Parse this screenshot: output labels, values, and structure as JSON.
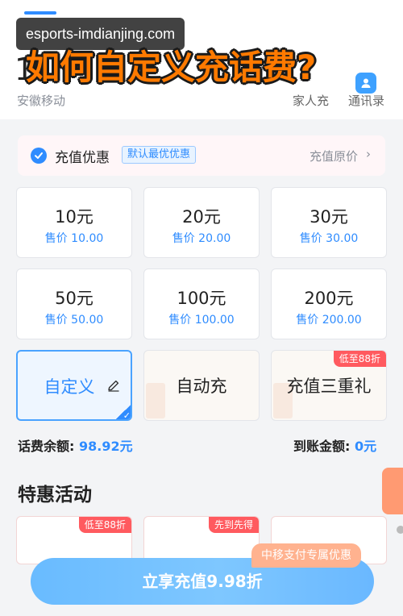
{
  "watermark": "esports-imdianjing.com",
  "overlay_title": "如何自定义充话费?",
  "header": {
    "phone_number": "1",
    "carrier": "安徽移动",
    "family_label": "家人充",
    "contacts_label": "通讯录"
  },
  "discount": {
    "title": "充值优惠",
    "badge": "默认最优优惠",
    "orig_price_link": "充值原价",
    "chevron": "›"
  },
  "cards": [
    {
      "amount": "10元",
      "price": "售价 10.00"
    },
    {
      "amount": "20元",
      "price": "售价 20.00"
    },
    {
      "amount": "30元",
      "price": "售价 30.00"
    },
    {
      "amount": "50元",
      "price": "售价 50.00"
    },
    {
      "amount": "100元",
      "price": "售价 100.00"
    },
    {
      "amount": "200元",
      "price": "售价 200.00"
    }
  ],
  "special_cards": {
    "custom": "自定义",
    "auto": "自动充",
    "gift": "充值三重礼",
    "gift_tag": "低至88折"
  },
  "balance": {
    "label": "话费余额: ",
    "value": "98.92元",
    "arrival_label": "到账金额: ",
    "arrival_value": "0元"
  },
  "special_section": {
    "title": "特惠活动",
    "tag1": "低至88折",
    "tag2": "先到先得"
  },
  "cta": {
    "pay_badge": "中移支付专属优惠",
    "label": "立享充值9.98折"
  },
  "colors": {
    "accent": "#2f8cff",
    "tag_red": "#ff5a5f",
    "overlay_orange": "#ff7a00"
  }
}
